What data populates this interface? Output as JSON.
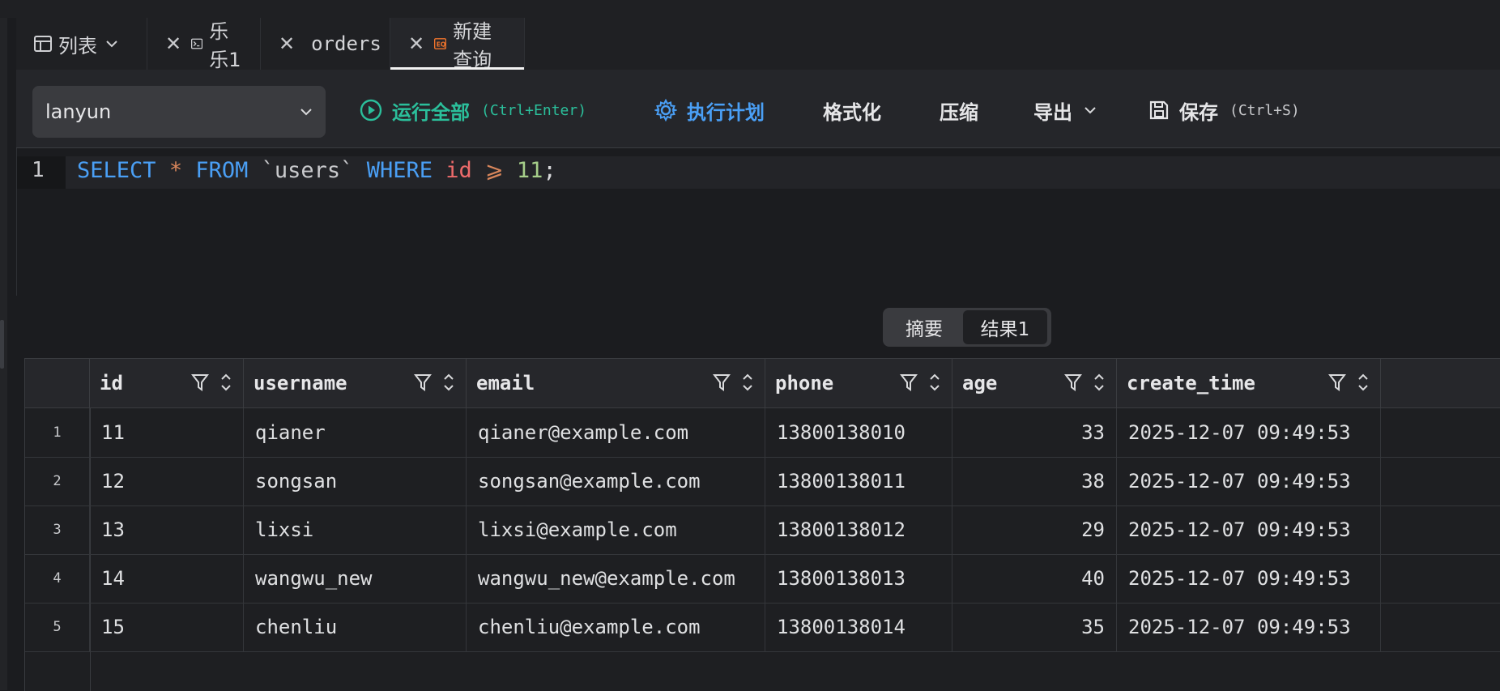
{
  "tabs": [
    {
      "label": "列表",
      "icon": "table-icon",
      "has_close": false,
      "has_dropdown": true,
      "active": false
    },
    {
      "label": "乐乐1",
      "icon": "terminal-icon",
      "has_close": true,
      "active": false
    },
    {
      "label": "orders",
      "icon": "table-icon",
      "has_close": true,
      "active": false
    },
    {
      "label": "新建查询",
      "icon": "query-icon",
      "has_close": true,
      "active": true
    }
  ],
  "toolbar": {
    "database": "lanyun",
    "run_all": "运行全部",
    "run_all_hint": "(Ctrl+Enter)",
    "explain": "执行计划",
    "format": "格式化",
    "compress": "压缩",
    "export": "导出",
    "save": "保存",
    "save_hint": "(Ctrl+S)"
  },
  "editor": {
    "line_number": "1",
    "tokens": {
      "select": "SELECT",
      "star": "*",
      "from": "FROM",
      "table": "`users`",
      "where": "WHERE",
      "column": "id",
      "operator": "⩾",
      "value": "11",
      "end": ";"
    }
  },
  "result_tabs": {
    "summary": "摘要",
    "result": "结果1",
    "active": "结果1"
  },
  "grid": {
    "columns": [
      "id",
      "username",
      "email",
      "phone",
      "age",
      "create_time"
    ],
    "rows": [
      {
        "index": "1",
        "cells": [
          "11",
          "qianer",
          "qianer@example.com",
          "13800138010",
          "33",
          "2025-12-07 09:49:53"
        ]
      },
      {
        "index": "2",
        "cells": [
          "12",
          "songsan",
          "songsan@example.com",
          "13800138011",
          "38",
          "2025-12-07 09:49:53"
        ]
      },
      {
        "index": "3",
        "cells": [
          "13",
          "lixsi",
          "lixsi@example.com",
          "13800138012",
          "29",
          "2025-12-07 09:49:53"
        ]
      },
      {
        "index": "4",
        "cells": [
          "14",
          "wangwu_new",
          "wangwu_new@example.com",
          "13800138013",
          "40",
          "2025-12-07 09:49:53"
        ]
      },
      {
        "index": "5",
        "cells": [
          "15",
          "chenliu",
          "chenliu@example.com",
          "13800138014",
          "35",
          "2025-12-07 09:49:53"
        ]
      }
    ]
  },
  "colors": {
    "accent_green": "#2bbf9b",
    "accent_blue": "#4a9ff5",
    "keyword": "#4a9ff5",
    "column": "#ee6b6b",
    "number": "#a6cf8a",
    "operator": "#d9865b",
    "query_icon": "#f0742c"
  }
}
